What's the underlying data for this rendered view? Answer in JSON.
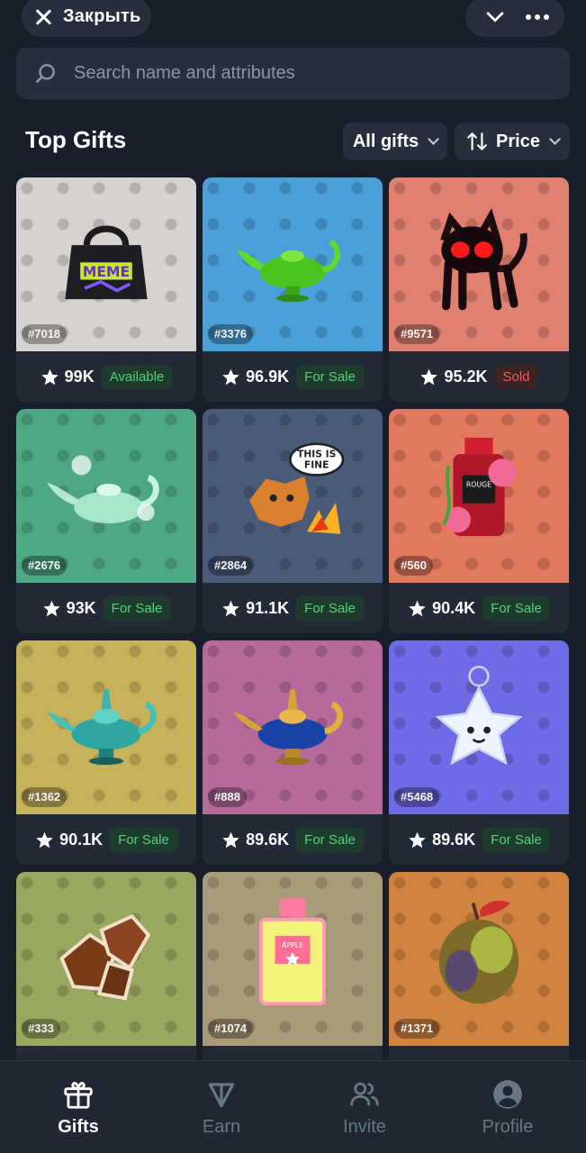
{
  "header": {
    "close_label": "Закрыть"
  },
  "search": {
    "placeholder": "Search name and attributes"
  },
  "section": {
    "title": "Top Gifts",
    "filter_label": "All gifts",
    "sort_label": "Price"
  },
  "gifts": [
    {
      "id": "#7018",
      "price": "99K",
      "status": "Available",
      "status_color": "green",
      "bg": "#d6d2cf",
      "art": "handbag-icon"
    },
    {
      "id": "#3376",
      "price": "96.9K",
      "status": "For Sale",
      "status_color": "green",
      "bg": "#4aa0d8",
      "art": "genie-lamp-green-icon"
    },
    {
      "id": "#9571",
      "price": "95.2K",
      "status": "Sold",
      "status_color": "red",
      "bg": "#e08070",
      "art": "black-cat-icon"
    },
    {
      "id": "#2676",
      "price": "93K",
      "status": "For Sale",
      "status_color": "green",
      "bg": "#4ea884",
      "art": "ghost-lamp-icon"
    },
    {
      "id": "#2864",
      "price": "91.1K",
      "status": "For Sale",
      "status_color": "green",
      "bg": "#4a5b7a",
      "art": "this-is-fine-icon"
    },
    {
      "id": "#560",
      "price": "90.4K",
      "status": "For Sale",
      "status_color": "green",
      "bg": "#e2785e",
      "art": "rouge-perfume-icon"
    },
    {
      "id": "#1362",
      "price": "90.1K",
      "status": "For Sale",
      "status_color": "green",
      "bg": "#c6b25a",
      "art": "teal-lamp-icon"
    },
    {
      "id": "#888",
      "price": "89.6K",
      "status": "For Sale",
      "status_color": "green",
      "bg": "#b66a9c",
      "art": "gold-lamp-icon"
    },
    {
      "id": "#5468",
      "price": "89.6K",
      "status": "For Sale",
      "status_color": "green",
      "bg": "#6f6ae6",
      "art": "star-keychain-icon"
    },
    {
      "id": "#333",
      "price": "",
      "status": "",
      "status_color": "green",
      "bg": "#98a85e",
      "art": "crystal-icon"
    },
    {
      "id": "#1074",
      "price": "",
      "status": "",
      "status_color": "green",
      "bg": "#a99a78",
      "art": "apple-perfume-icon"
    },
    {
      "id": "#1371",
      "price": "",
      "status": "",
      "status_color": "green",
      "bg": "#d18440",
      "art": "plum-fruit-icon"
    }
  ],
  "nav": {
    "gifts": "Gifts",
    "earn": "Earn",
    "invite": "Invite",
    "profile": "Profile"
  },
  "colors": {
    "background": "#181f2a",
    "surface": "#262f3b",
    "status_green": "#4ed37c",
    "status_red": "#f15b5b"
  }
}
